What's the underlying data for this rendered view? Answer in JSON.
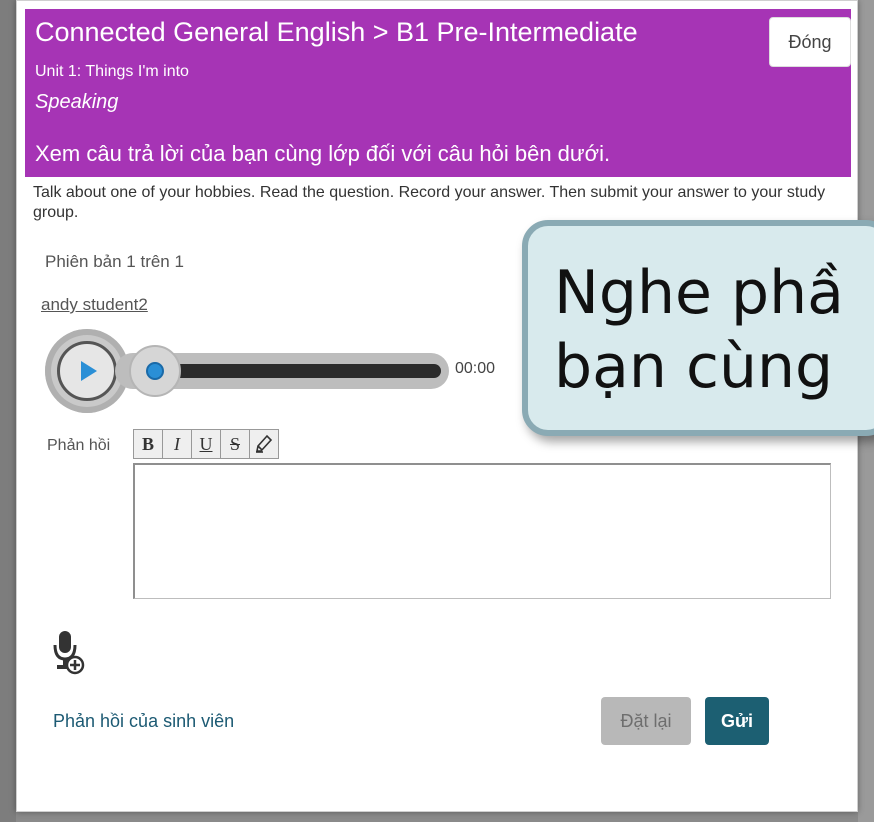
{
  "dialog": {
    "title": "Connected General English > B1 Pre-Intermediate",
    "unit": "Unit 1: Things I'm into",
    "section": "Speaking",
    "instruction": "Xem câu trả lời của bạn cùng lớp đối với câu hỏi bên dưới.",
    "close_label": "Đóng"
  },
  "prompt": "Talk about one of your hobbies. Read the question. Record your answer. Then submit your answer to your study group.",
  "version": "Phiên bản 1 trên 1",
  "student_name": "andy student2",
  "player": {
    "time": "00:00",
    "progress": 0
  },
  "feedback": {
    "label": "Phản hồi",
    "toolbar": [
      "B",
      "I",
      "U",
      "S",
      "highlighter"
    ]
  },
  "student_feedback_link": "Phản hồi của sinh viên",
  "buttons": {
    "reset": "Đặt lại",
    "submit": "Gửi"
  },
  "callout": {
    "line1": "Nghe phầ",
    "line2": "bạn cùng"
  },
  "colors": {
    "header": "#a634b5",
    "submit": "#1c5f72",
    "play": "#2a8fd6"
  }
}
